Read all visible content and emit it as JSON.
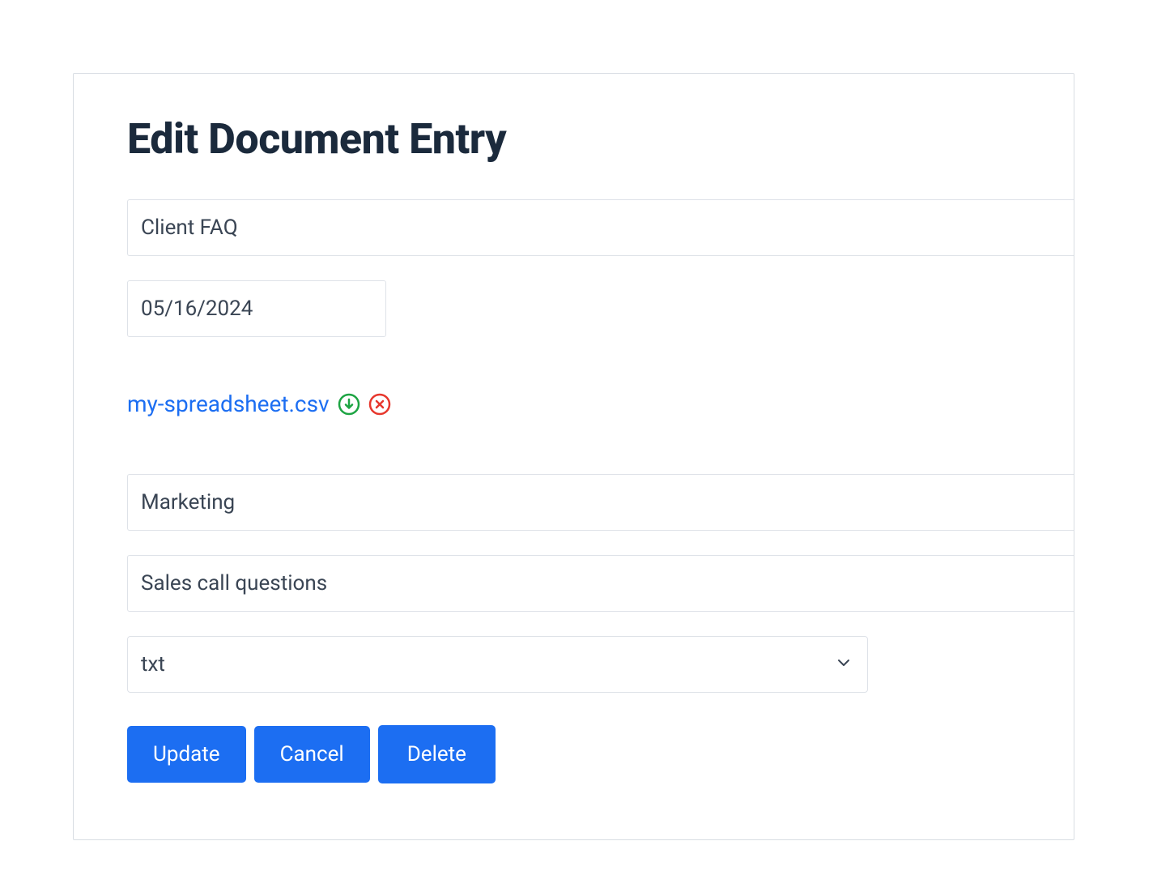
{
  "title": "Edit Document Entry",
  "form": {
    "document_name": "Client FAQ",
    "date": "05/16/2024",
    "category": "Marketing",
    "description": "Sales call questions",
    "file_type": "txt"
  },
  "attachment": {
    "filename": "my-spreadsheet.csv"
  },
  "buttons": {
    "update": "Update",
    "cancel": "Cancel",
    "delete": "Delete"
  }
}
